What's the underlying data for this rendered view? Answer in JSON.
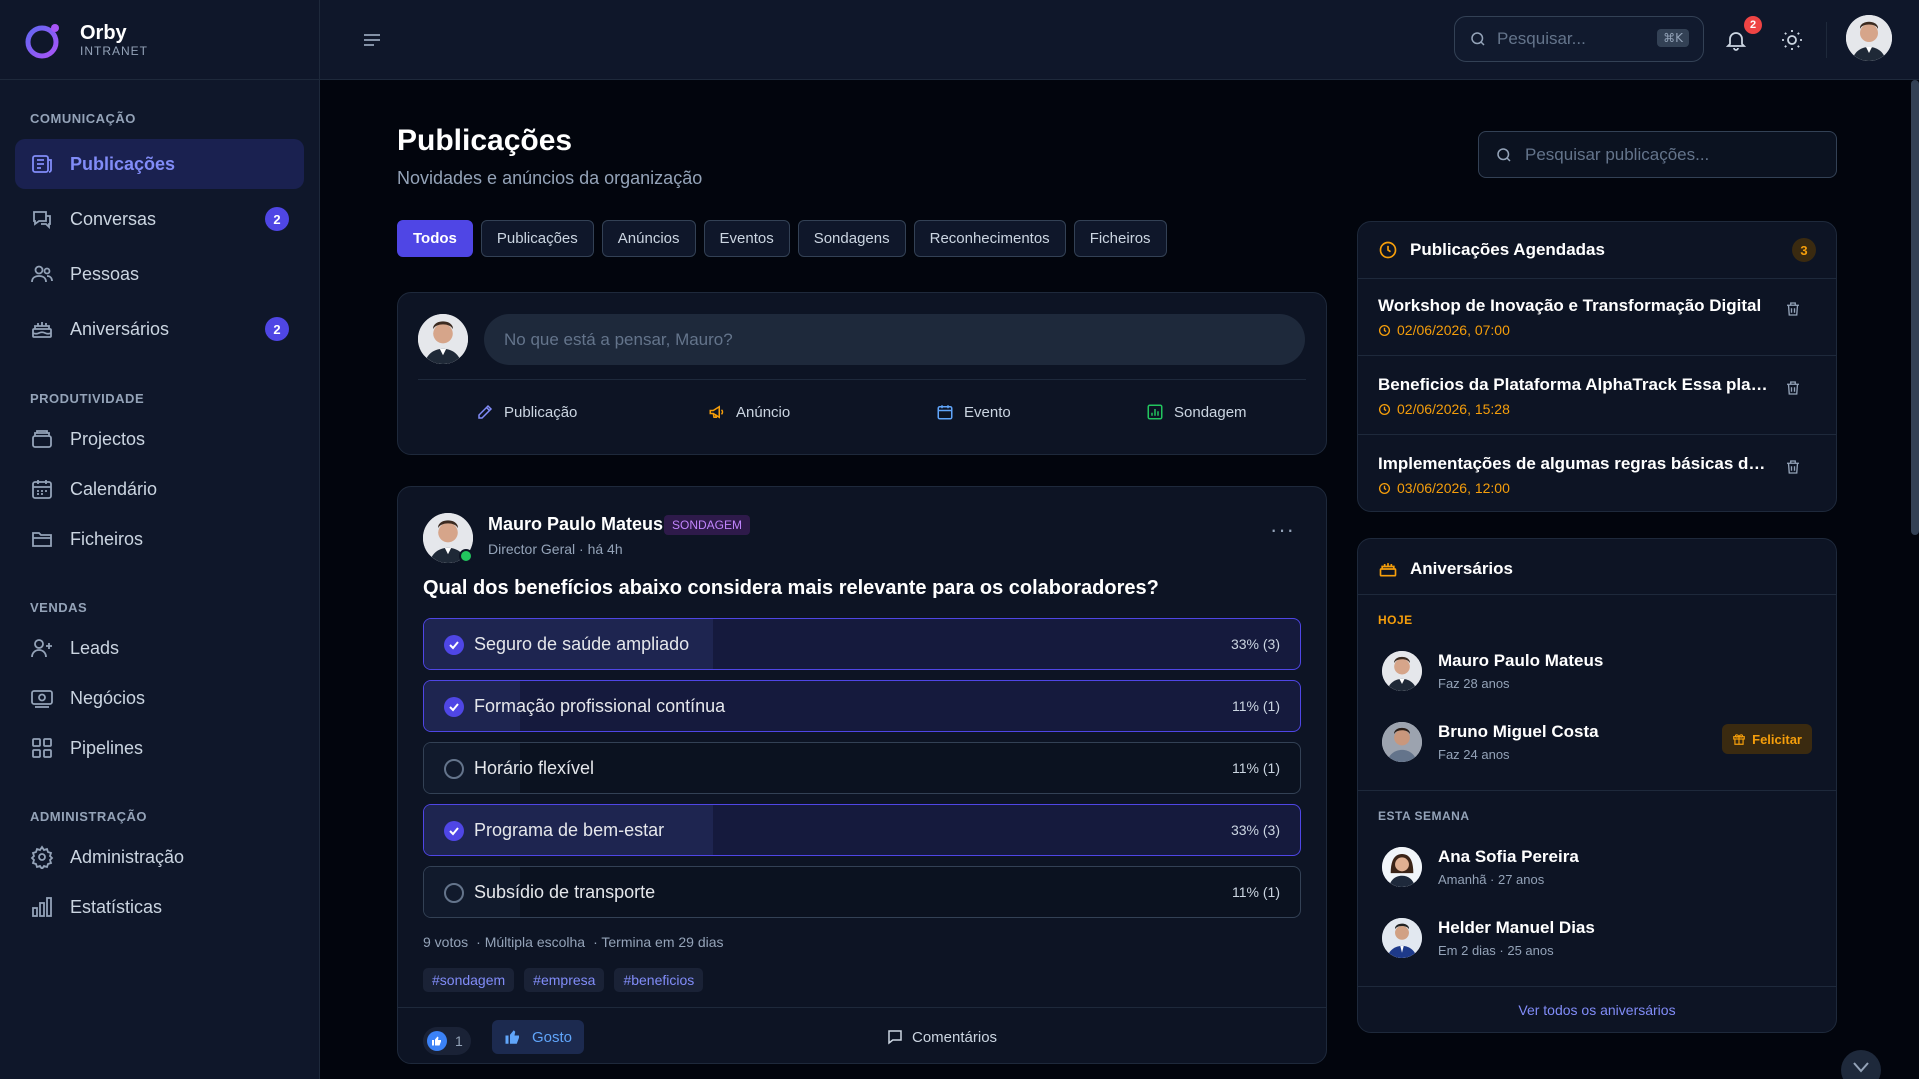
{
  "brand": {
    "name": "Orby",
    "subtitle": "INTRANET"
  },
  "sidebar": {
    "sections": [
      {
        "label": "COMUNICAÇÃO"
      },
      {
        "label": "PRODUTIVIDADE"
      },
      {
        "label": "VENDAS"
      },
      {
        "label": "ADMINISTRAÇÃO"
      }
    ],
    "items": [
      {
        "label": "Publicações",
        "icon": "newspaper-icon",
        "active": true
      },
      {
        "label": "Conversas",
        "icon": "chat-icon",
        "badge": "2"
      },
      {
        "label": "Pessoas",
        "icon": "users-icon"
      },
      {
        "label": "Aniversários",
        "icon": "cake-icon",
        "badge": "2"
      },
      {
        "label": "Projectos",
        "icon": "folder-stack-icon"
      },
      {
        "label": "Calendário",
        "icon": "calendar-icon"
      },
      {
        "label": "Ficheiros",
        "icon": "folder-icon"
      },
      {
        "label": "Leads",
        "icon": "user-plus-icon"
      },
      {
        "label": "Negócios",
        "icon": "money-icon"
      },
      {
        "label": "Pipelines",
        "icon": "grid-icon"
      },
      {
        "label": "Administração",
        "icon": "gear-icon"
      },
      {
        "label": "Estatísticas",
        "icon": "bar-chart-icon"
      }
    ]
  },
  "topbar": {
    "search_placeholder": "Pesquisar...",
    "shortcut": "⌘K",
    "notifications_count": "2"
  },
  "page": {
    "title": "Publicações",
    "subtitle": "Novidades e anúncios da organização",
    "search_placeholder": "Pesquisar publicações..."
  },
  "tabs": [
    {
      "label": "Todos",
      "active": true
    },
    {
      "label": "Publicações"
    },
    {
      "label": "Anúncios"
    },
    {
      "label": "Eventos"
    },
    {
      "label": "Sondagens"
    },
    {
      "label": "Reconhecimentos"
    },
    {
      "label": "Ficheiros"
    }
  ],
  "composer": {
    "placeholder": "No que está a pensar, Mauro?",
    "actions": [
      {
        "label": "Publicação",
        "color": "#818cf8"
      },
      {
        "label": "Anúncio",
        "color": "#f59e0b"
      },
      {
        "label": "Evento",
        "color": "#60a5fa"
      },
      {
        "label": "Sondagem",
        "color": "#22c55e"
      }
    ]
  },
  "post": {
    "author": "Mauro Paulo Mateus",
    "tag": "SONDAGEM",
    "meta": "Director Geral · há 4h",
    "question": "Qual dos benefícios abaixo considera mais relevante para os colaboradores?",
    "options": [
      {
        "label": "Seguro de saúde ampliado",
        "pct": "33% (3)",
        "fraction": 0.33,
        "selected": true
      },
      {
        "label": "Formação profissional contínua",
        "pct": "11% (1)",
        "fraction": 0.11,
        "selected": true
      },
      {
        "label": "Horário flexível",
        "pct": "11% (1)",
        "fraction": 0.11,
        "selected": false
      },
      {
        "label": "Programa de bem-estar",
        "pct": "33% (3)",
        "fraction": 0.33,
        "selected": true
      },
      {
        "label": "Subsídio de transporte",
        "pct": "11% (1)",
        "fraction": 0.11,
        "selected": false
      }
    ],
    "votes": "9 votos",
    "mode": "· Múltipla escolha",
    "ends": "· Termina em 29 dias",
    "hashtags": [
      "#sondagem",
      "#empresa",
      "#beneficios"
    ],
    "reaction_count": "1",
    "like_label": "Gosto",
    "comments_label": "Comentários"
  },
  "scheduled": {
    "title": "Publicações Agendadas",
    "count": "3",
    "items": [
      {
        "title": "Workshop de Inovação e Transformação Digital",
        "date": "02/06/2026, 07:00"
      },
      {
        "title": "Beneficios da Plataforma AlphaTrack Essa plataforma",
        "date": "02/06/2026, 15:28"
      },
      {
        "title": "Implementações de algumas regras básicas dentro da empresa",
        "date": "03/06/2026, 12:00"
      }
    ]
  },
  "birthdays": {
    "title": "Aniversários",
    "today_label": "HOJE",
    "week_label": "ESTA SEMANA",
    "today": [
      {
        "name": "Mauro Paulo Mateus",
        "meta": "Faz 28 anos"
      },
      {
        "name": "Bruno Miguel Costa",
        "meta": "Faz 24 anos",
        "action": "Felicitar"
      }
    ],
    "week": [
      {
        "name": "Ana Sofia Pereira",
        "meta": "Amanhã · 27 anos"
      },
      {
        "name": "Helder Manuel Dias",
        "meta": "Em 2 dias · 25 anos"
      }
    ],
    "see_all": "Ver todos os aniversários"
  }
}
